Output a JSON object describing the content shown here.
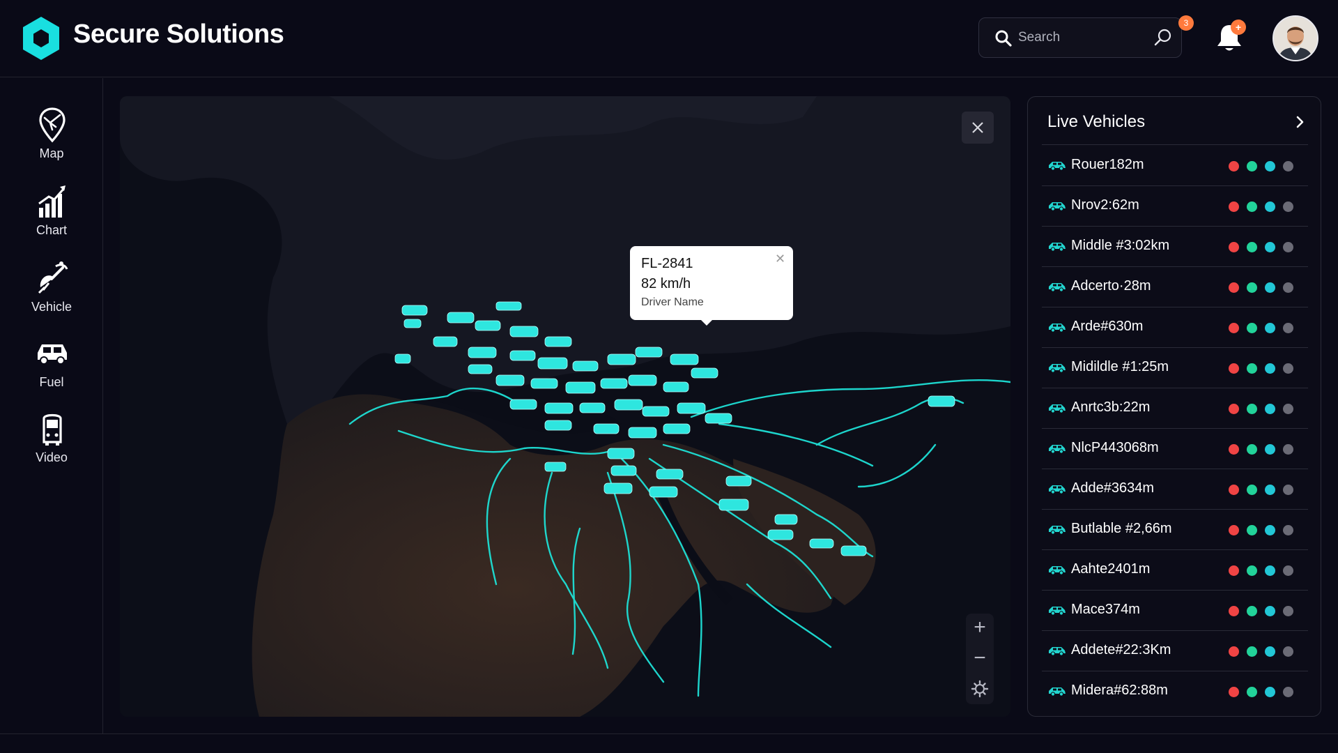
{
  "header": {
    "brand": "Secure Solutions",
    "search_placeholder": "Search",
    "search_badge": "3",
    "notification_badge": "+"
  },
  "sidebar": {
    "items": [
      {
        "label": "Map",
        "icon": "map-pin-icon"
      },
      {
        "label": "Chart",
        "icon": "bar-chart-icon"
      },
      {
        "label": "Vehicle",
        "icon": "satellite-icon"
      },
      {
        "label": "Fuel",
        "icon": "car-icon"
      },
      {
        "label": "Video",
        "icon": "bus-icon"
      }
    ]
  },
  "map": {
    "popup": {
      "id": "FL-2841",
      "speed": "82 km/h",
      "driver": "Driver Name"
    },
    "close_symbol": "✕",
    "zoom_in": "+",
    "zoom_out": "−"
  },
  "live_vehicles": {
    "title": "Live Vehicles",
    "items": [
      {
        "name": "Rouer182m"
      },
      {
        "name": "Nrov2:62m"
      },
      {
        "name": "Middle #3:02km"
      },
      {
        "name": "Adcerto·28m"
      },
      {
        "name": "Arde#630m"
      },
      {
        "name": "Midildle #1:25m"
      },
      {
        "name": "Anrtc3b:22m"
      },
      {
        "name": "NlcP443068m"
      },
      {
        "name": "Adde#3634m"
      },
      {
        "name": "Butlable #2,66m"
      },
      {
        "name": "Aahte2401m"
      },
      {
        "name": "Mace374m"
      },
      {
        "name": "Addete#22:3Km"
      },
      {
        "name": "Midera#62:88m"
      }
    ],
    "status_colors": [
      "#f04444",
      "#22d39a",
      "#22c7d6",
      "#6b6b76"
    ]
  },
  "colors": {
    "accent": "#1ee0d6",
    "background": "#0a0a17",
    "badge": "#ff7a3d"
  }
}
